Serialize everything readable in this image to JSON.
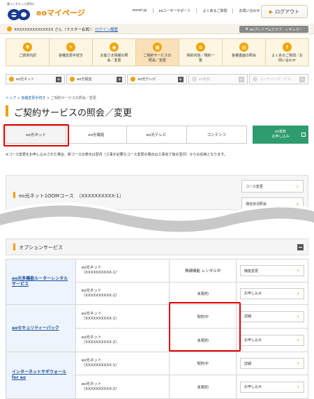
{
  "header": {
    "tagline": "暮らしをもっと便利に",
    "logo_text": "eo",
    "site_title": "eoマイページ",
    "links": [
      "eonet.jp",
      "eoユーザーサポート",
      "よくあるご質問",
      "お問い合わせ"
    ],
    "logout_label": "ログアウト"
  },
  "userbar": {
    "user_name": "XXXXXXXXXXXXXXX さん（マスター会員）",
    "login_history": "ログイン履歴",
    "premium_label": "eoプレミアムクラブ：レギュラー"
  },
  "menu": [
    {
      "label": "ご請求内訳",
      "icon": "¥"
    },
    {
      "label": "各種変更手続き",
      "icon": "✎"
    },
    {
      "label": "お客さま情報の照\n会／変更",
      "icon": "◉"
    },
    {
      "label": "ご契約サービスの\n照会／変更",
      "icon": "▦"
    },
    {
      "label": "契約内容／規約一\n覧",
      "icon": "≡"
    },
    {
      "label": "各種書面の照会",
      "icon": "▤"
    },
    {
      "label": "よくあるご質問／お\n問い合わせ",
      "icon": "?"
    }
  ],
  "service_tabs": [
    "eo光ネット",
    "eo光電話",
    "eo光テレビ",
    "eo電気",
    "コンテンツサービス"
  ],
  "breadcrumb": {
    "top": "トップ",
    "sep": ">",
    "step": "各種変更手続き",
    "current": "ご契約サービスの照会／変更"
  },
  "page_title": "ご契約サービスの照会／変更",
  "content_tabs": [
    "eo光ネット",
    "eo光電話",
    "eo光テレビ",
    "コンテンツ"
  ],
  "apply_button": "eo電気\nお申し込み",
  "note": "※コース変更をお申し込みされた場合、新コースの表示は翌月（工事が必要なコース変更の場合は工事完了後の翌月）からの反映となります。",
  "course": {
    "name": "eo光ネット1OOMコース　（XXXXXXXXXX-1）",
    "buttons": [
      "コース変更",
      "通信状況照会"
    ]
  },
  "options": {
    "title": "オプションサービス",
    "rows": [
      {
        "service": "eo光多機能ルーターレンタルサービス",
        "lines": [
          {
            "line1": "eo光ネット",
            "line2": "（XXXXXXXXXX-1）",
            "status": "無線機能 レンタル中",
            "action": "機能変更"
          },
          {
            "line1": "eo光ネット",
            "line2": "（XXXXXXXXXX-2）",
            "status": "未契約",
            "action": "お申し込み"
          }
        ]
      },
      {
        "service": "eoセキュリティーパック",
        "lines": [
          {
            "line1": "eo光ネット",
            "line2": "（XXXXXXXXXX-1）",
            "status": "契約中",
            "action": "詳細"
          },
          {
            "line1": "eo光ネット",
            "line2": "（XXXXXXXXXX-2）",
            "status": "未契約",
            "action": "お申し込み"
          }
        ]
      },
      {
        "service": "インターネットサギウォール for eo",
        "lines": [
          {
            "line1": "eo光ネット",
            "line2": "（XXXXXXXXXX-1）",
            "status": "契約中",
            "action": "詳細"
          },
          {
            "line1": "eo光ネット",
            "line2": "（XXXXXXXXXX-2）",
            "status": "未契約",
            "action": "お申し込み"
          }
        ]
      }
    ]
  },
  "colors": {
    "accent": "#f0a000",
    "brand_green": "#2e9c6e",
    "highlight_red": "#e20000",
    "link_blue": "#1a5fb4"
  }
}
